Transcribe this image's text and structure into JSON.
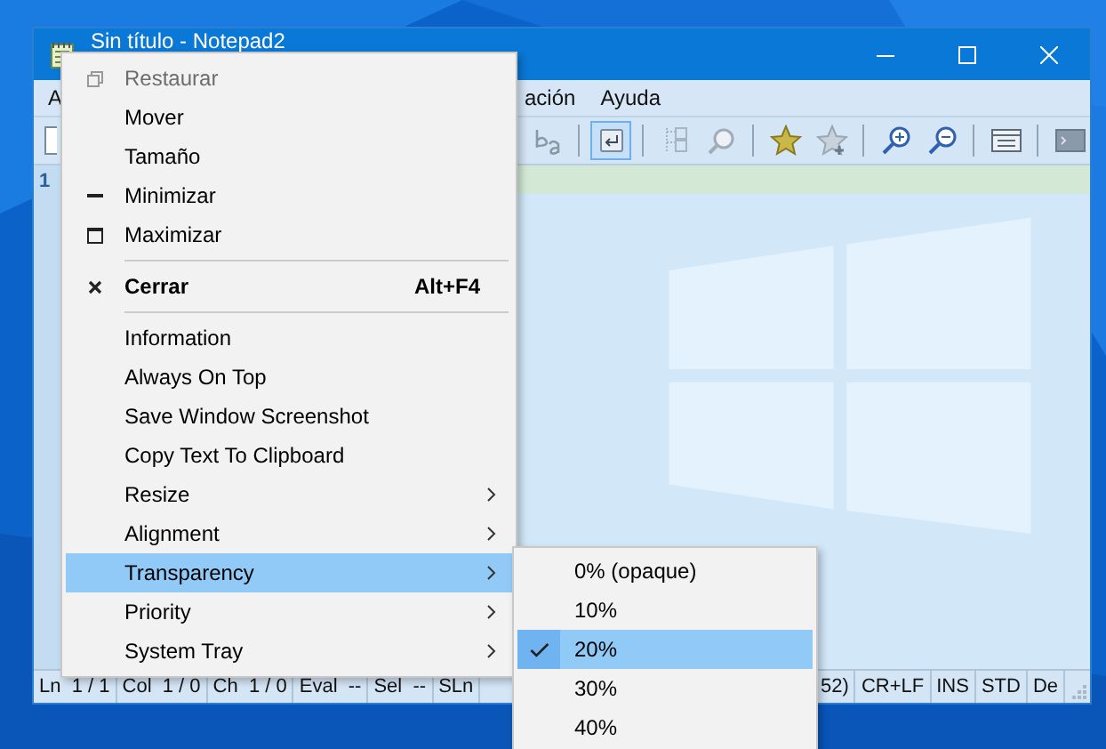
{
  "window": {
    "title": "Sin título - Notepad2"
  },
  "menu_bar": {
    "left": [
      "A"
    ],
    "right": [
      "ación",
      "Ayuda"
    ]
  },
  "toolbar": {
    "left": [
      {
        "kind": "new"
      }
    ],
    "right": [
      {
        "kind": "find"
      },
      {
        "kind": "replace"
      },
      {
        "kind": "sep"
      },
      {
        "kind": "wrap",
        "pressed": true
      },
      {
        "kind": "sep"
      },
      {
        "kind": "split"
      },
      {
        "kind": "zoomreset"
      },
      {
        "kind": "sep"
      },
      {
        "kind": "star"
      },
      {
        "kind": "staradd"
      },
      {
        "kind": "sep"
      },
      {
        "kind": "zoomin"
      },
      {
        "kind": "zoomout"
      },
      {
        "kind": "sep"
      },
      {
        "kind": "window"
      },
      {
        "kind": "sep"
      },
      {
        "kind": "screen"
      }
    ]
  },
  "editor": {
    "line_numbers": [
      "1"
    ]
  },
  "status_bar": {
    "left": [
      "Ln  1 / 1",
      "Col  1 / 0",
      "Ch  1 / 0",
      "Eval  --",
      "Sel  --",
      "SLn"
    ],
    "right": [
      "52)",
      "CR+LF",
      "INS",
      "STD",
      "De"
    ]
  },
  "system_menu": [
    {
      "kind": "restore",
      "label": "Restaurar",
      "disabled": true,
      "selected": false
    },
    {
      "kind": "plain",
      "label": "Mover",
      "disabled": false,
      "selected": false
    },
    {
      "kind": "plain",
      "label": "Tamaño",
      "disabled": false,
      "selected": false
    },
    {
      "kind": "minimize",
      "label": "Minimizar",
      "disabled": false,
      "selected": false
    },
    {
      "kind": "maximize",
      "label": "Maximizar",
      "disabled": false,
      "selected": false
    },
    {
      "kind": "separator"
    },
    {
      "kind": "close",
      "label": "Cerrar",
      "shortcut": "Alt+F4",
      "disabled": false,
      "selected": false
    },
    {
      "kind": "separator"
    },
    {
      "kind": "plain",
      "label": "Information",
      "disabled": false,
      "selected": false
    },
    {
      "kind": "plain",
      "label": "Always On Top",
      "disabled": false,
      "selected": false
    },
    {
      "kind": "plain",
      "label": "Save Window Screenshot",
      "disabled": false,
      "selected": false
    },
    {
      "kind": "plain",
      "label": "Copy Text To Clipboard",
      "disabled": false,
      "selected": false
    },
    {
      "kind": "submenu",
      "label": "Resize",
      "disabled": false,
      "selected": false
    },
    {
      "kind": "submenu",
      "label": "Alignment",
      "disabled": false,
      "selected": false
    },
    {
      "kind": "submenu",
      "label": "Transparency",
      "disabled": false,
      "selected": true
    },
    {
      "kind": "submenu",
      "label": "Priority",
      "disabled": false,
      "selected": false
    },
    {
      "kind": "submenu",
      "label": "System Tray",
      "disabled": false,
      "selected": false
    }
  ],
  "transparency_menu": [
    {
      "label": "0% (opaque)",
      "checked": false,
      "selected": false
    },
    {
      "label": "10%",
      "checked": false,
      "selected": false
    },
    {
      "label": "20%",
      "checked": true,
      "selected": true
    },
    {
      "label": "30%",
      "checked": false,
      "selected": false
    },
    {
      "label": "40%",
      "checked": false,
      "selected": false
    }
  ]
}
